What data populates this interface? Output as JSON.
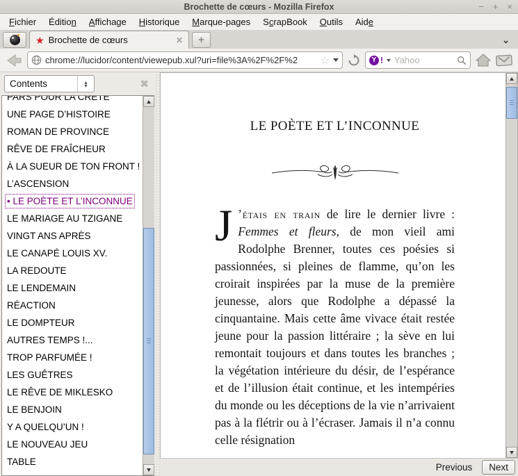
{
  "window": {
    "title": "Brochette de cœurs - Mozilla Firefox",
    "minimize": "−",
    "maximize": "+",
    "close": "×"
  },
  "menubar": {
    "items": [
      {
        "pre": "",
        "key": "F",
        "post": "ichier"
      },
      {
        "pre": "Éditio",
        "key": "n",
        "post": ""
      },
      {
        "pre": "",
        "key": "A",
        "post": "ffichage"
      },
      {
        "pre": "",
        "key": "H",
        "post": "istorique"
      },
      {
        "pre": "",
        "key": "M",
        "post": "arque-pages"
      },
      {
        "pre": "S",
        "key": "c",
        "post": "rapBook"
      },
      {
        "pre": "",
        "key": "O",
        "post": "utils"
      },
      {
        "pre": "Aid",
        "key": "e",
        "post": ""
      }
    ]
  },
  "tabbar": {
    "tab_title": "Brochette de cœurs",
    "close_glyph": "✕",
    "new_tab_glyph": "+",
    "alltabs_glyph": "⌄"
  },
  "navbar": {
    "url": "chrome://lucidor/content/viewepub.xul?uri=file%3A%2F%2F%2",
    "bookmark_star": "☆",
    "search_placeholder": "Yahoo",
    "search_engine_glyph": "Y"
  },
  "sidebar": {
    "selector_value": "Contents",
    "close_glyph": "✖",
    "items": [
      {
        "label": "PARS POUR LA CRÈTE",
        "selected": false
      },
      {
        "label": "UNE PAGE D’HISTOIRE",
        "selected": false
      },
      {
        "label": "ROMAN DE PROVINCE",
        "selected": false
      },
      {
        "label": "RÊVE DE FRAÎCHEUR",
        "selected": false
      },
      {
        "label": "À LA SUEUR DE TON FRONT !",
        "selected": false
      },
      {
        "label": "L’ASCENSION",
        "selected": false
      },
      {
        "label": "• LE POÈTE ET L’INCONNUE",
        "selected": true
      },
      {
        "label": "LE MARIAGE AU TZIGANE",
        "selected": false
      },
      {
        "label": "VINGT ANS APRÈS",
        "selected": false
      },
      {
        "label": "LE CANAPÉ LOUIS XV.",
        "selected": false
      },
      {
        "label": "LA REDOUTE",
        "selected": false
      },
      {
        "label": "LE LENDEMAIN",
        "selected": false
      },
      {
        "label": "RÉACTION",
        "selected": false
      },
      {
        "label": "LE DOMPTEUR",
        "selected": false
      },
      {
        "label": "AUTRES TEMPS !...",
        "selected": false
      },
      {
        "label": "TROP PARFUMÉE !",
        "selected": false
      },
      {
        "label": "LES GUÊTRES",
        "selected": false
      },
      {
        "label": "LE RÊVE DE MIKLESKO",
        "selected": false
      },
      {
        "label": "LE BENJOIN",
        "selected": false
      },
      {
        "label": "Y A QUELQU’UN !",
        "selected": false
      },
      {
        "label": "LE NOUVEAU JEU",
        "selected": false
      },
      {
        "label": "TABLE",
        "selected": false
      }
    ]
  },
  "content": {
    "chapter_title": "LE POÈTE ET L’INCONNUE",
    "dropcap": "J",
    "lead_smallcaps": "’étais en train",
    "segment_1": " de lire le dernier livre : ",
    "book_title_italic": "Femmes et fleurs",
    "segment_2": ", de mon vieil ami Rodolphe Brenner, toutes ces poésies si passionnées, si pleines de flamme, qu’on les croirait inspirées par la muse de la première jeunesse, alors que Rodolphe a dépassé la cinquantaine. Mais cette âme vivace était restée jeune pour la passion littéraire ; la sève en lui remontait toujours et dans toutes les branches ; la végétation intérieure du désir, de l’espérance et de l’illusion était continue, et les intempéries du monde ou les déceptions de la vie n’arrivaient pas à la flétrir ou à l’écraser. Jamais il n’a connu celle résignation"
  },
  "statusbar": {
    "previous_label": "Previous",
    "next_label": "Next"
  },
  "colors": {
    "accent_selected": "#800080",
    "tab_star": "#e01b24",
    "yahoo_purple": "#720e9e",
    "scroll_thumb": "#a7c2e6"
  }
}
